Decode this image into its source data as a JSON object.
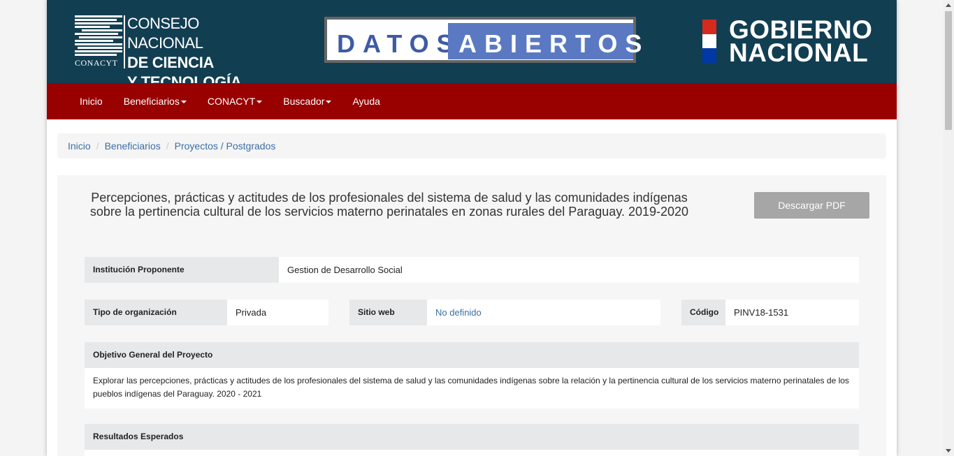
{
  "header": {
    "conacyt": {
      "line1": "CONSEJO NACIONAL",
      "line2": "DE CIENCIA",
      "line3": "Y TECNOLOGÍA",
      "acronym": "CONACYT"
    },
    "datos_abiertos": {
      "left": "DATOS",
      "right": "ABIERTOS"
    },
    "gobierno": {
      "line1": "GOBIERNO",
      "line2": "NACIONAL"
    }
  },
  "nav": {
    "items": [
      {
        "label": "Inicio",
        "dropdown": false
      },
      {
        "label": "Beneficiarios",
        "dropdown": true
      },
      {
        "label": "CONACYT",
        "dropdown": true
      },
      {
        "label": "Buscador",
        "dropdown": true
      },
      {
        "label": "Ayuda",
        "dropdown": false
      }
    ]
  },
  "breadcrumb": [
    "Inicio",
    "Beneficiarios",
    "Proyectos / Postgrados"
  ],
  "project": {
    "title": "Percepciones, prácticas y actitudes de los profesionales del sistema de salud y las comunidades indígenas sobre la pertinencia cultural de los servicios materno perinatales en zonas rurales del Paraguay. 2019-2020",
    "download_label": "Descargar PDF",
    "institucion_label": "Institución Proponente",
    "institucion_value": "Gestion de Desarrollo Social",
    "tipo_label": "Tipo de organización",
    "tipo_value": "Privada",
    "sitio_label": "Sitio web",
    "sitio_value": "No definido",
    "codigo_label": "Código",
    "codigo_value": "PINV18-1531",
    "objetivo_label": "Objetivo General del Proyecto",
    "objetivo_value": "Explorar las percepciones, prácticas y actitudes de los profesionales del sistema de salud y las comunidades indígenas sobre la relación y la pertinencia cultural de los servicios materno perinatales de los pueblos indígenas del Paraguay. 2020 - 2021",
    "resultados_label": "Resultados Esperados"
  },
  "colors": {
    "header_bg": "#123e52",
    "nav_bg": "#990000",
    "link": "#3a6ea5",
    "button_disabled": "#a6a6a6"
  }
}
